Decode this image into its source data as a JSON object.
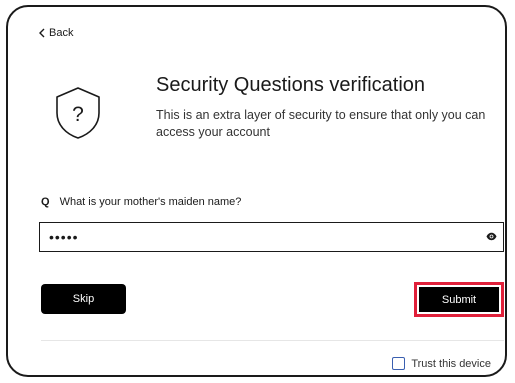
{
  "nav": {
    "back_label": "Back"
  },
  "header": {
    "title": "Security Questions verification",
    "subtitle": "This is an extra layer of security to ensure that only you can access your account"
  },
  "question": {
    "marker": "Q",
    "text": "What is your mother's maiden name?",
    "answer_value": "•••••"
  },
  "actions": {
    "skip_label": "Skip",
    "submit_label": "Submit"
  },
  "trust": {
    "label": "Trust this device",
    "checked": false
  },
  "colors": {
    "highlight": "#e0203a",
    "button_bg": "#000000",
    "checkbox_border": "#3a5fb0"
  },
  "icons": {
    "back": "chevron-left-icon",
    "shield": "shield-question-icon",
    "reveal": "eye-icon"
  }
}
